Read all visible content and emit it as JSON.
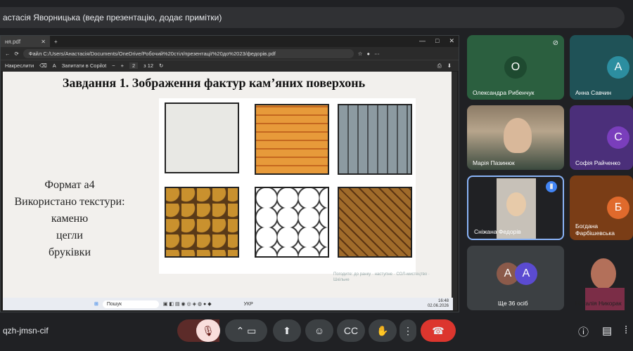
{
  "presenter_bar": {
    "text": "астасія Яворницька (веде презентацію, додає примітки)"
  },
  "browser": {
    "tab_label": "ня.pdf",
    "address": "C:/Users/Анастасія/Documents/OneDrive/Робочий%20стіл/презентації%20до%2023/федорів.pdf",
    "address_prefix": "Файл",
    "pdf_toolbar": {
      "draw": "Накреслити",
      "copilot": "Запитати в Copilot",
      "page": "2",
      "page_total": "з 12"
    }
  },
  "slide": {
    "title": "Завдання 1. Зображення фактур кам’яних поверхонь",
    "lines": [
      "Формат а4",
      "Використано текстури:",
      "каменю",
      "цегли",
      "бруківки"
    ],
    "watermark": "Погодите: до ранку · наступне · СОЛ-мистецтво · Шкільне"
  },
  "taskbar": {
    "search": "Пошук",
    "lang": "УКР",
    "time": "16:48",
    "date": "02.06.2026"
  },
  "participants": [
    {
      "name": "Олександра Рибенчук",
      "initial": "О",
      "color": "#2b5f3f",
      "avatar_color": "#1e4a30"
    },
    {
      "name": "Анна Савчин",
      "initial": "А",
      "color": "#1f5257",
      "avatar_color": "#2c8ea0"
    },
    {
      "name": "Марія Пазинюк",
      "initial": "",
      "color": "#6b5a48",
      "avatar_color": ""
    },
    {
      "name": "Софія Райченко",
      "initial": "С",
      "color": "#4b2f7a",
      "avatar_color": "#7a3ebc"
    },
    {
      "name": "Сніжана Федорів",
      "initial": "",
      "color": "#3c4043",
      "avatar_color": ""
    },
    {
      "name": "Богдана Фарбішевська",
      "initial": "Б",
      "color": "#7a3d16",
      "avatar_color": "#e06a2c"
    },
    {
      "name": "Ще 36 осіб",
      "initial": "A",
      "color": "#3c4043",
      "avatar_color": "#8b5a4a"
    },
    {
      "name": "Наталія Никорак",
      "initial": "",
      "color": "#c9c4bf",
      "avatar_color": ""
    }
  ],
  "more_avatars": [
    "A",
    "A"
  ],
  "meeting": {
    "code": "qzh-jmsn-cif"
  }
}
